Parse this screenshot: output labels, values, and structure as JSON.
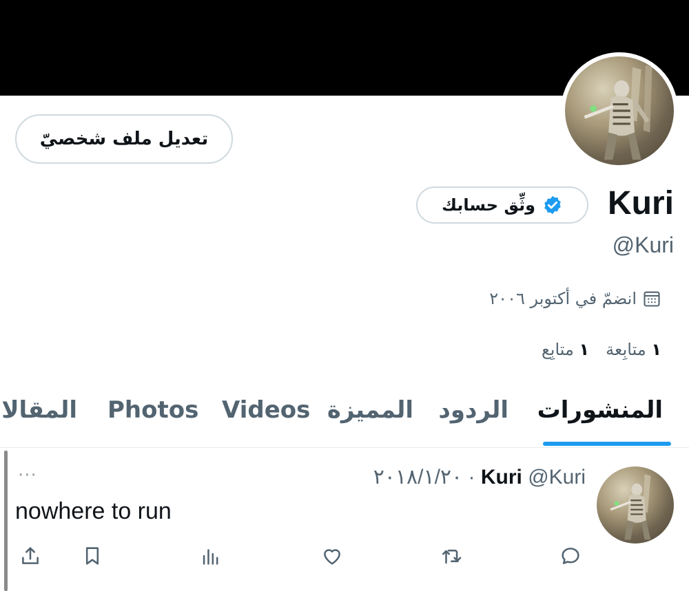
{
  "profile": {
    "edit_button": "تعديل ملف شخصيّ",
    "display_name": "Kuri",
    "verify_label": "وثِّق حسابك",
    "handle": "@Kuri",
    "joined": "انضمّ في أكتوبر ٢٠٠٦",
    "following_count": "١",
    "following_label": "متابِعة",
    "followers_count": "١",
    "followers_label": "متابِع"
  },
  "tabs": [
    {
      "label": "المنشورات",
      "active": true
    },
    {
      "label": "الردود"
    },
    {
      "label": "المميزة"
    },
    {
      "label": "Videos"
    },
    {
      "label": "Photos"
    },
    {
      "label": "المقالات"
    }
  ],
  "tweet": {
    "name": "Kuri",
    "handle": "@Kuri",
    "separator": "·",
    "date": "٢٠١٨/١/٢٠",
    "text": "nowhere to run",
    "more": "···"
  },
  "icons": {
    "verified": "verified-badge-icon",
    "calendar": "calendar-icon",
    "reply": "reply-icon",
    "retweet": "retweet-icon",
    "like": "heart-icon",
    "views": "views-icon",
    "bookmark": "bookmark-icon",
    "share": "share-icon"
  },
  "colors": {
    "accent": "#1d9bf0",
    "text": "#0f1419",
    "muted": "#536471",
    "banner": "#000000"
  }
}
